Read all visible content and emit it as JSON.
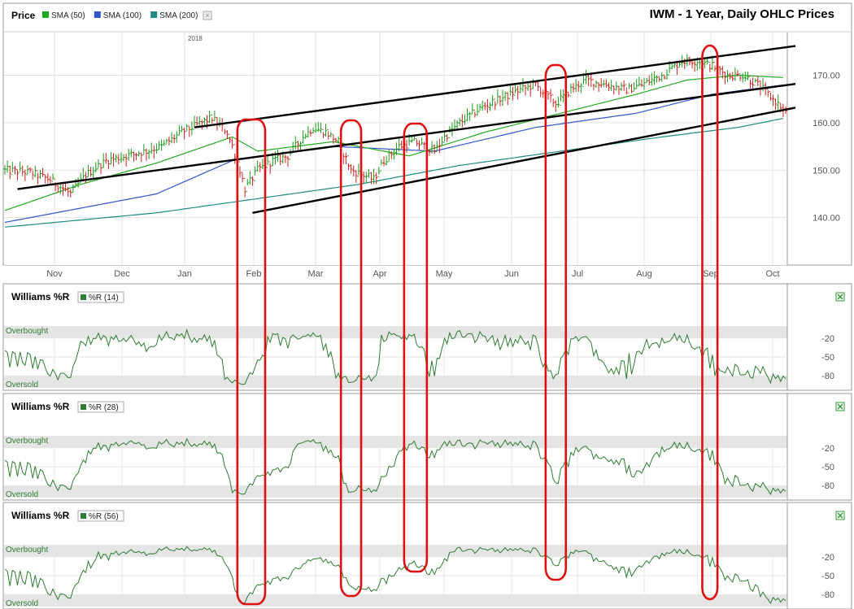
{
  "chart_data": [
    {
      "type": "ohlc",
      "title": "IWM - 1 Year, Daily OHLC Prices",
      "panel_label": "Price",
      "year_marker": "2018",
      "legend": [
        {
          "label": "SMA (50)",
          "color": "#22aa22"
        },
        {
          "label": "SMA (100)",
          "color": "#3355cc"
        },
        {
          "label": "SMA (200)",
          "color": "#1e8c80"
        }
      ],
      "x_months": [
        "Nov",
        "Dec",
        "Jan",
        "Feb",
        "Mar",
        "Apr",
        "May",
        "Jun",
        "Jul",
        "Aug",
        "Sep",
        "Oct"
      ],
      "y_ticks": [
        "170.00",
        "160.00",
        "150.00",
        "140.00"
      ],
      "ylim": [
        130,
        179
      ],
      "price_anchors": [
        [
          0,
          150
        ],
        [
          10,
          149.5
        ],
        [
          18,
          148
        ],
        [
          26,
          145
        ],
        [
          32,
          149
        ],
        [
          40,
          152
        ],
        [
          48,
          153
        ],
        [
          56,
          154
        ],
        [
          62,
          155
        ],
        [
          70,
          158
        ],
        [
          78,
          160
        ],
        [
          82,
          161
        ],
        [
          88,
          158
        ],
        [
          92,
          152
        ],
        [
          95,
          146
        ],
        [
          100,
          150
        ],
        [
          106,
          152
        ],
        [
          112,
          153
        ],
        [
          118,
          157
        ],
        [
          122,
          159
        ],
        [
          127,
          158
        ],
        [
          132,
          156
        ],
        [
          137,
          150
        ],
        [
          142,
          149
        ],
        [
          146,
          148
        ],
        [
          150,
          152
        ],
        [
          156,
          155
        ],
        [
          162,
          156
        ],
        [
          166,
          155
        ],
        [
          170,
          154
        ],
        [
          174,
          157
        ],
        [
          180,
          160
        ],
        [
          188,
          163
        ],
        [
          196,
          165
        ],
        [
          204,
          167
        ],
        [
          210,
          168
        ],
        [
          214,
          166
        ],
        [
          218,
          164
        ],
        [
          224,
          167
        ],
        [
          230,
          169
        ],
        [
          238,
          168
        ],
        [
          246,
          167
        ],
        [
          252,
          168
        ],
        [
          260,
          170
        ],
        [
          268,
          173
        ],
        [
          274,
          173
        ],
        [
          280,
          172
        ],
        [
          286,
          170
        ],
        [
          292,
          170
        ],
        [
          298,
          168
        ],
        [
          302,
          166
        ],
        [
          306,
          164
        ],
        [
          309,
          162
        ]
      ],
      "sma50": [
        [
          0,
          141.5
        ],
        [
          30,
          147
        ],
        [
          60,
          151.5
        ],
        [
          90,
          157
        ],
        [
          100,
          154
        ],
        [
          130,
          156
        ],
        [
          160,
          153
        ],
        [
          190,
          158
        ],
        [
          220,
          162
        ],
        [
          250,
          166
        ],
        [
          270,
          169
        ],
        [
          290,
          170
        ],
        [
          309,
          169.5
        ]
      ],
      "sma100": [
        [
          0,
          139
        ],
        [
          60,
          145
        ],
        [
          90,
          152
        ],
        [
          130,
          155
        ],
        [
          170,
          154
        ],
        [
          210,
          159
        ],
        [
          250,
          162
        ],
        [
          280,
          166
        ],
        [
          309,
          168
        ]
      ],
      "sma200": [
        [
          0,
          138
        ],
        [
          60,
          141
        ],
        [
          100,
          144
        ],
        [
          140,
          147
        ],
        [
          180,
          151
        ],
        [
          220,
          154
        ],
        [
          260,
          157
        ],
        [
          290,
          159
        ],
        [
          309,
          161
        ]
      ],
      "trendlines": [
        [
          [
            5,
            146
          ],
          [
            309,
            168
          ]
        ],
        [
          [
            75,
            159
          ],
          [
            309,
            176
          ]
        ],
        [
          [
            98,
            141
          ],
          [
            309,
            163
          ]
        ]
      ],
      "highlight_ranges": [
        [
          92,
          103
        ],
        [
          133,
          141
        ],
        [
          158,
          167
        ],
        [
          214,
          222
        ],
        [
          276,
          282
        ]
      ]
    },
    {
      "type": "line",
      "title": "Williams %R",
      "legend": "%R (14)",
      "period": 14,
      "ylim": [
        -100,
        0
      ],
      "y_ticks": [
        "-20",
        "-50",
        "-80"
      ],
      "zones": {
        "overbought": "Overbought",
        "oversold": "Oversold"
      }
    },
    {
      "type": "line",
      "title": "Williams %R",
      "legend": "%R (28)",
      "period": 28,
      "ylim": [
        -100,
        0
      ],
      "y_ticks": [
        "-20",
        "-50",
        "-80"
      ],
      "zones": {
        "overbought": "Overbought",
        "oversold": "Oversold"
      }
    },
    {
      "type": "line",
      "title": "Williams %R",
      "legend": "%R (56)",
      "period": 56,
      "ylim": [
        -100,
        0
      ],
      "y_ticks": [
        "-20",
        "-50",
        "-80"
      ],
      "zones": {
        "overbought": "Overbought",
        "oversold": "Oversold"
      }
    }
  ]
}
